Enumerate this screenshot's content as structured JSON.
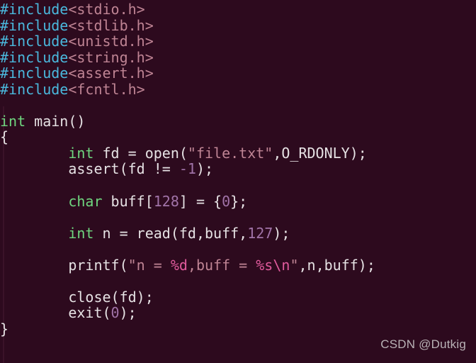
{
  "editor": {
    "background_color": "#2d0a1e",
    "colors": {
      "preprocessor": "#4ab8dd",
      "header": "#bf8494",
      "type_keyword": "#6fd67f",
      "plain": "#e6e2e4",
      "number": "#a173a8",
      "string": "#bf8494",
      "escape": "#e05a9c"
    }
  },
  "watermark": {
    "text": "CSDN @Dutkig"
  },
  "code": {
    "language": "c",
    "plain_text": "#include<stdio.h>\n#include<stdlib.h>\n#include<unistd.h>\n#include<string.h>\n#include<assert.h>\n#include<fcntl.h>\n\nint main()\n{\n        int fd = open(\"file.txt\",O_RDONLY);\n        assert(fd != -1);\n\n        char buff[128] = {0};\n\n        int n = read(fd,buff,127);\n\n        printf(\"n = %d,buff = %s\\n\",n,buff);\n\n        close(fd);\n        exit(0);\n}",
    "lines": [
      {
        "tokens": [
          {
            "t": "#include",
            "c": "pre"
          },
          {
            "t": "<stdio.h>",
            "c": "header"
          }
        ]
      },
      {
        "tokens": [
          {
            "t": "#include",
            "c": "pre"
          },
          {
            "t": "<stdlib.h>",
            "c": "header"
          }
        ]
      },
      {
        "tokens": [
          {
            "t": "#include",
            "c": "pre"
          },
          {
            "t": "<unistd.h>",
            "c": "header"
          }
        ]
      },
      {
        "tokens": [
          {
            "t": "#include",
            "c": "pre"
          },
          {
            "t": "<string.h>",
            "c": "header"
          }
        ]
      },
      {
        "tokens": [
          {
            "t": "#include",
            "c": "pre"
          },
          {
            "t": "<assert.h>",
            "c": "header"
          }
        ]
      },
      {
        "tokens": [
          {
            "t": "#include",
            "c": "pre"
          },
          {
            "t": "<fcntl.h>",
            "c": "header"
          }
        ]
      },
      {
        "tokens": []
      },
      {
        "tokens": [
          {
            "t": "int",
            "c": "type"
          },
          {
            "t": " main()",
            "c": "plain"
          }
        ]
      },
      {
        "tokens": [
          {
            "t": "{",
            "c": "plain"
          }
        ]
      },
      {
        "tokens": [
          {
            "t": "        ",
            "c": "plain"
          },
          {
            "t": "int",
            "c": "type"
          },
          {
            "t": " fd = open(",
            "c": "plain"
          },
          {
            "t": "\"file.txt\"",
            "c": "str"
          },
          {
            "t": ",O_RDONLY);",
            "c": "plain"
          }
        ]
      },
      {
        "tokens": [
          {
            "t": "        assert(fd != ",
            "c": "plain"
          },
          {
            "t": "-1",
            "c": "num"
          },
          {
            "t": ");",
            "c": "plain"
          }
        ]
      },
      {
        "tokens": []
      },
      {
        "tokens": [
          {
            "t": "        ",
            "c": "plain"
          },
          {
            "t": "char",
            "c": "type"
          },
          {
            "t": " buff[",
            "c": "plain"
          },
          {
            "t": "128",
            "c": "num"
          },
          {
            "t": "] = {",
            "c": "plain"
          },
          {
            "t": "0",
            "c": "num"
          },
          {
            "t": "};",
            "c": "plain"
          }
        ]
      },
      {
        "tokens": []
      },
      {
        "tokens": [
          {
            "t": "        ",
            "c": "plain"
          },
          {
            "t": "int",
            "c": "type"
          },
          {
            "t": " n = read(fd,buff,",
            "c": "plain"
          },
          {
            "t": "127",
            "c": "num"
          },
          {
            "t": ");",
            "c": "plain"
          }
        ]
      },
      {
        "tokens": []
      },
      {
        "tokens": [
          {
            "t": "        printf(",
            "c": "plain"
          },
          {
            "t": "\"n = ",
            "c": "str"
          },
          {
            "t": "%d",
            "c": "esc"
          },
          {
            "t": ",buff = ",
            "c": "str"
          },
          {
            "t": "%s",
            "c": "esc"
          },
          {
            "t": "\\n",
            "c": "esc"
          },
          {
            "t": "\"",
            "c": "str"
          },
          {
            "t": ",n,buff);",
            "c": "plain"
          }
        ]
      },
      {
        "tokens": []
      },
      {
        "tokens": [
          {
            "t": "        close(fd);",
            "c": "plain"
          }
        ]
      },
      {
        "tokens": [
          {
            "t": "        exit(",
            "c": "plain"
          },
          {
            "t": "0",
            "c": "num"
          },
          {
            "t": ");",
            "c": "plain"
          }
        ]
      },
      {
        "tokens": [
          {
            "t": "}",
            "c": "plain"
          }
        ]
      }
    ]
  }
}
